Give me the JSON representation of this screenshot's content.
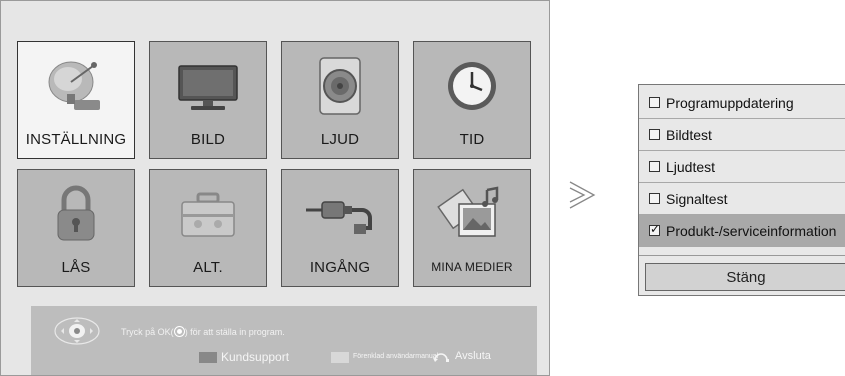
{
  "menu": {
    "tiles": [
      {
        "label": "INSTÄLLNING",
        "icon": "satellite-dish-icon",
        "selected": true
      },
      {
        "label": "BILD",
        "icon": "tv-screen-icon",
        "selected": false
      },
      {
        "label": "LJUD",
        "icon": "speaker-icon",
        "selected": false
      },
      {
        "label": "TID",
        "icon": "clock-icon",
        "selected": false
      },
      {
        "label": "LÅS",
        "icon": "padlock-icon",
        "selected": false
      },
      {
        "label": "ALT.",
        "icon": "toolbox-icon",
        "selected": false
      },
      {
        "label": "INGÅNG",
        "icon": "cable-plug-icon",
        "selected": false
      },
      {
        "label": "MINA MEDIER",
        "icon": "media-photos-icon",
        "selected": false
      }
    ]
  },
  "hint": {
    "prefix": "Tryck på OK(",
    "suffix": ") för att ställa in program.",
    "support_label": "Kundsupport",
    "manual_label": "Förenklad användarmanual",
    "exit_label": "Avsluta"
  },
  "popup": {
    "options": [
      {
        "label": "Programuppdatering",
        "checked": false
      },
      {
        "label": "Bildtest",
        "checked": false
      },
      {
        "label": "Ljudtest",
        "checked": false
      },
      {
        "label": "Signaltest",
        "checked": false
      },
      {
        "label": "Produkt-/serviceinformation",
        "checked": true
      }
    ],
    "close_label": "Stäng"
  },
  "colors": {
    "tile": "#b8b8b8",
    "tile_selected": "#f4f4f4",
    "hintbar": "#bdbdbd",
    "option_checked": "#a9a9a9"
  }
}
